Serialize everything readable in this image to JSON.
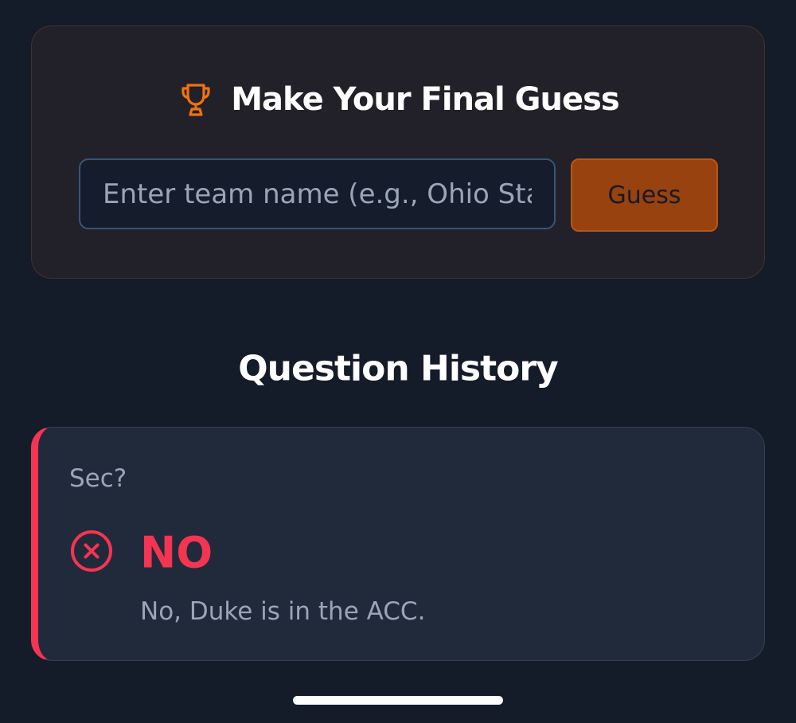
{
  "final_guess": {
    "title": "Make Your Final Guess",
    "icon": "trophy-icon",
    "input_placeholder": "Enter team name (e.g., Ohio State)",
    "input_value": "",
    "button_label": "Guess"
  },
  "history": {
    "title": "Question History",
    "items": [
      {
        "question": "Sec?",
        "answer": "NO",
        "answer_icon": "x-circle-icon",
        "explanation": "No, Duke is in the ACC."
      }
    ]
  },
  "colors": {
    "background": "#141b29",
    "accent_orange": "#f0730f",
    "button_orange": "#97420f",
    "no_red": "#f43551",
    "card_dark": "#22212a",
    "history_card": "#212a3b"
  }
}
